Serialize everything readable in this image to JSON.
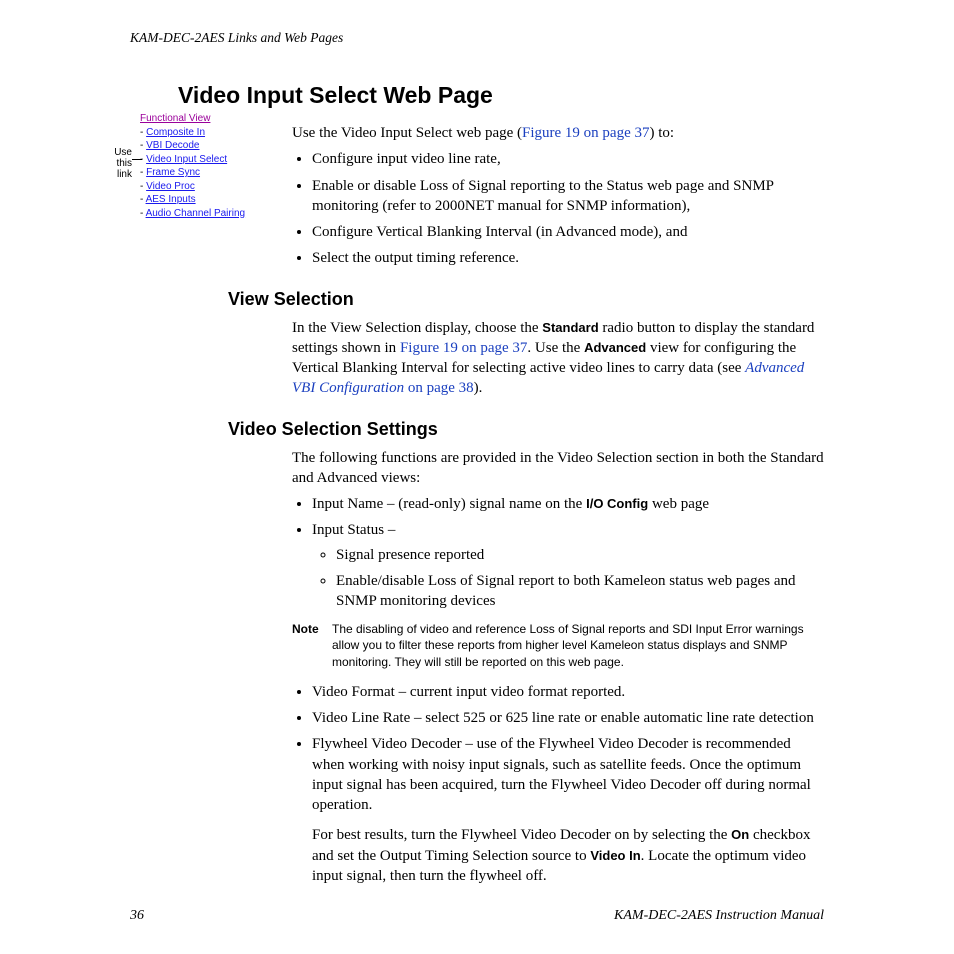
{
  "running_header": "KAM-DEC-2AES Links and Web Pages",
  "h1": "Video Input Select Web Page",
  "intro": {
    "p1a": "Use the Video Input Select web page (",
    "p1link": "Figure 19 on page 37",
    "p1b": ") to:",
    "bullets": [
      "Configure input video line rate,",
      "Enable or disable Loss of Signal reporting to the Status web page and SNMP monitoring (refer to 2000NET manual for SNMP information),",
      "Configure Vertical Blanking Interval (in Advanced mode), and",
      "Select the output timing reference."
    ]
  },
  "view_sel": {
    "h": "View Selection",
    "p_a": "In the View Selection display, choose the ",
    "standard": "Standard",
    "p_b": " radio button to display the standard settings shown in ",
    "link1": "Figure 19 on page 37",
    "p_c": ". Use the ",
    "advanced": "Advanced",
    "p_d": " view for configuring the Vertical Blanking Interval for selecting active video lines to carry data (see ",
    "link2a": "Advanced VBI Configuration",
    "link2b": " on page 38",
    "p_e": ")."
  },
  "vss": {
    "h": "Video Selection Settings",
    "p1": "The following functions are provided in the Video Selection section in both the Standard and Advanced views:",
    "b1a": "Input Name – (read-only) signal name on the ",
    "b1bold": "I/O Config",
    "b1b": " web page",
    "b2": "Input Status –",
    "b2s1": "Signal presence reported",
    "b2s2": "Enable/disable Loss of Signal report to both Kameleon status web pages and SNMP monitoring devices",
    "note_label": "Note",
    "note": "The disabling of video and reference Loss of Signal reports and SDI Input Error warnings allow you to filter these reports from higher level Kameleon status displays and SNMP monitoring. They will still be reported on this web page.",
    "b3": "Video Format – current input video format reported.",
    "b4": "Video Line Rate – select 525 or 625 line rate or enable automatic line rate detection",
    "b5": "Flywheel Video Decoder – use of the Flywheel Video Decoder is recommended when working with noisy input signals, such as satellite feeds. Once the optimum input signal has been acquired, turn the Flywheel Video Decoder off during normal operation.",
    "p2a": "For best results, turn the Flywheel Video Decoder on by selecting the ",
    "on": "On",
    "p2b": " checkbox and set the Output Timing Selection source to ",
    "videoin": "Video In",
    "p2c": ". Locate the optimum video input signal, then turn the flywheel off."
  },
  "sidebar": {
    "use": "Use this link",
    "title": "Functional View",
    "items": [
      "Composite In",
      "VBI Decode",
      "Video Input Select",
      "Frame Sync",
      "Video Proc",
      "AES Inputs",
      "Audio Channel Pairing"
    ]
  },
  "footer": {
    "page": "36",
    "doc": "KAM-DEC-2AES Instruction Manual"
  }
}
